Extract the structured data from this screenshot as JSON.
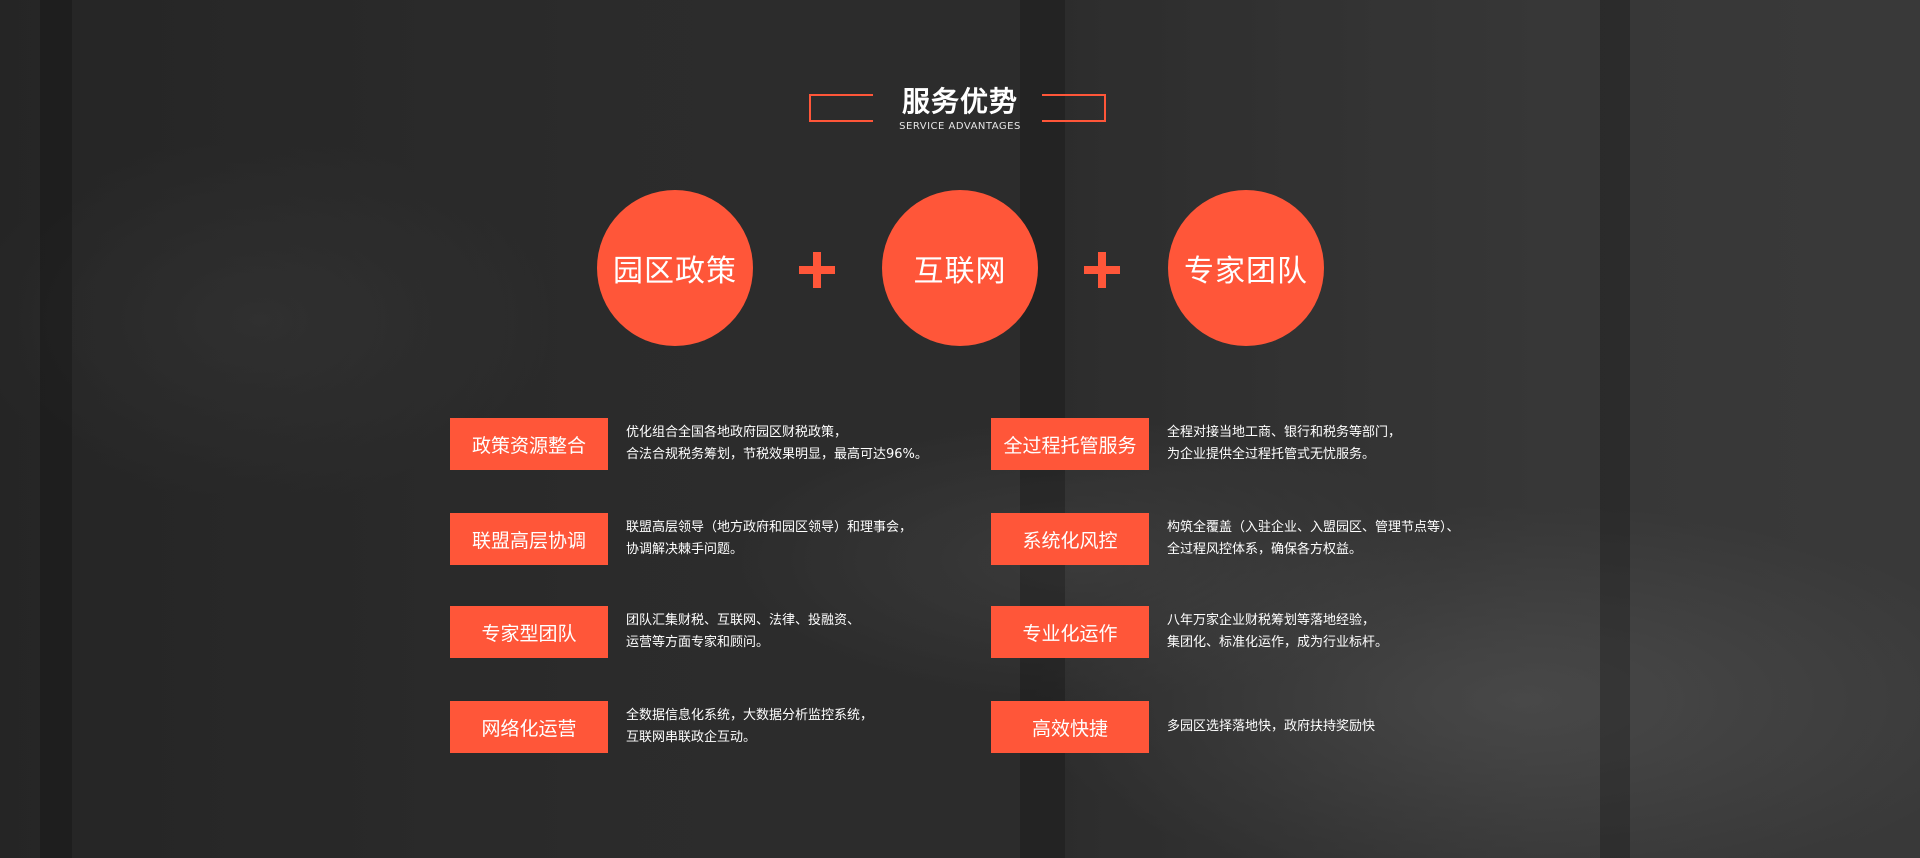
{
  "header": {
    "title": "服务优势",
    "subtitle": "SERVICE ADVANTAGES"
  },
  "pillars": [
    {
      "label": "园区政策"
    },
    {
      "label": "互联网"
    },
    {
      "label": "专家团队"
    }
  ],
  "features_left": [
    {
      "tag": "政策资源整合",
      "line1": "优化组合全国各地政府园区财税政策，",
      "line2": "合法合规税务筹划，节税效果明显，最高可达96%。"
    },
    {
      "tag": "联盟高层协调",
      "line1": "联盟高层领导（地方政府和园区领导）和理事会，",
      "line2": "协调解决棘手问题。"
    },
    {
      "tag": "专家型团队",
      "line1": "团队汇集财税、互联网、法律、投融资、",
      "line2": "运营等方面专家和顾问。"
    },
    {
      "tag": "网络化运营",
      "line1": "全数据信息化系统，大数据分析监控系统，",
      "line2": "互联网串联政企互动。"
    }
  ],
  "features_right": [
    {
      "tag": "全过程托管服务",
      "line1": "全程对接当地工商、银行和税务等部门，",
      "line2": "为企业提供全过程托管式无忧服务。"
    },
    {
      "tag": "系统化风控",
      "line1": "构筑全覆盖（入驻企业、入盟园区、管理节点等）、",
      "line2": "全过程风控体系，确保各方权益。"
    },
    {
      "tag": "专业化运作",
      "line1": "八年万家企业财税筹划等落地经验，",
      "line2": "集团化、标准化运作，成为行业标杆。"
    },
    {
      "tag": "高效快捷",
      "line1": "多园区选择落地快，政府扶持奖励快",
      "line2": ""
    }
  ],
  "colors": {
    "accent": "#ff5639",
    "text": "#ffffff"
  },
  "icons": [
    "plus-icon"
  ]
}
